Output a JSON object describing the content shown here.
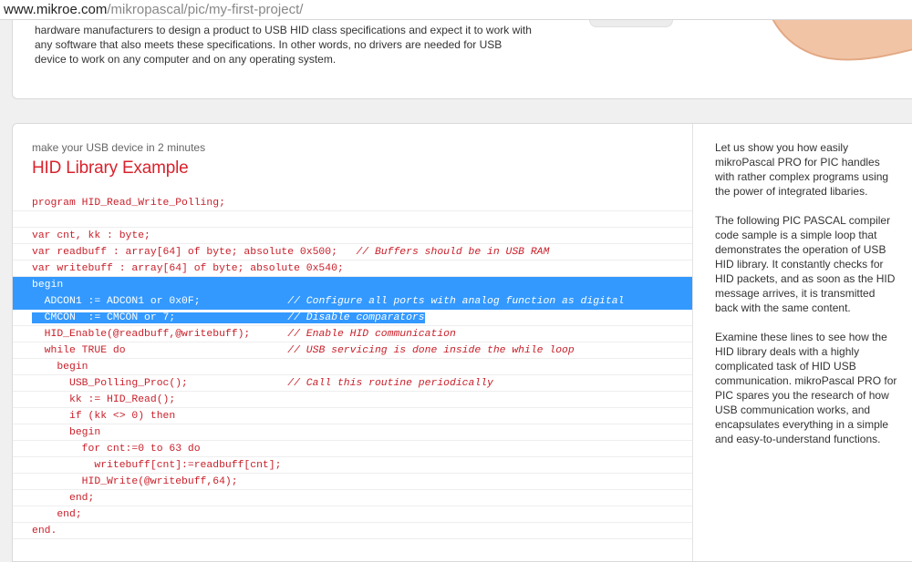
{
  "address_bar": {
    "host": "www.mikroe.com",
    "path": "/mikropascal/pic/my-first-project/"
  },
  "top_card": {
    "text": "hardware manufacturers to design a product to USB HID class specifications and expect it to work with any software that also meets these specifications. In other words, no drivers are needed for USB device to work on any computer and on any operating system."
  },
  "main": {
    "subtitle": "make your USB device in 2 minutes",
    "title": "HID Library Example",
    "code_lines": [
      "program HID_Read_Write_Polling;",
      "",
      "var cnt, kk : byte;",
      "var readbuff : array[64] of byte; absolute 0x500;   // Buffers should be in USB RAM",
      "var writebuff : array[64] of byte; absolute 0x540;",
      "begin",
      "  ADCON1 := ADCON1 or 0x0F;              // Configure all ports with analog function as digital",
      "  CMCON  := CMCON or 7;                  // Disable comparators",
      "  HID_Enable(@readbuff,@writebuff);      // Enable HID communication",
      "  while TRUE do                          // USB servicing is done inside the while loop",
      "    begin",
      "      USB_Polling_Proc();                // Call this routine periodically",
      "      kk := HID_Read();",
      "      if (kk <> 0) then",
      "      begin",
      "        for cnt:=0 to 63 do",
      "          writebuff[cnt]:=readbuff[cnt];",
      "        HID_Write(@writebuff,64);",
      "      end;",
      "    end;",
      "end."
    ],
    "side_paragraphs": [
      "Let us show you how easily mikroPascal PRO for PIC handles with rather complex programs using the power of integrated libaries.",
      "The following PIC PASCAL compiler code sample is a simple loop that demonstrates the operation of USB HID library. It constantly checks for HID packets, and as soon as the HID message arrives, it is transmitted back with the same content.",
      "Examine these lines to see how the HID library deals with a highly complicated task of HID USB communication. mikroPascal PRO for PIC spares you the research of how USB communication works, and encapsulates everything in a simple and easy-to-understand functions."
    ]
  },
  "colors": {
    "accent_red": "#d9232d",
    "selection_blue": "#3399ff"
  }
}
